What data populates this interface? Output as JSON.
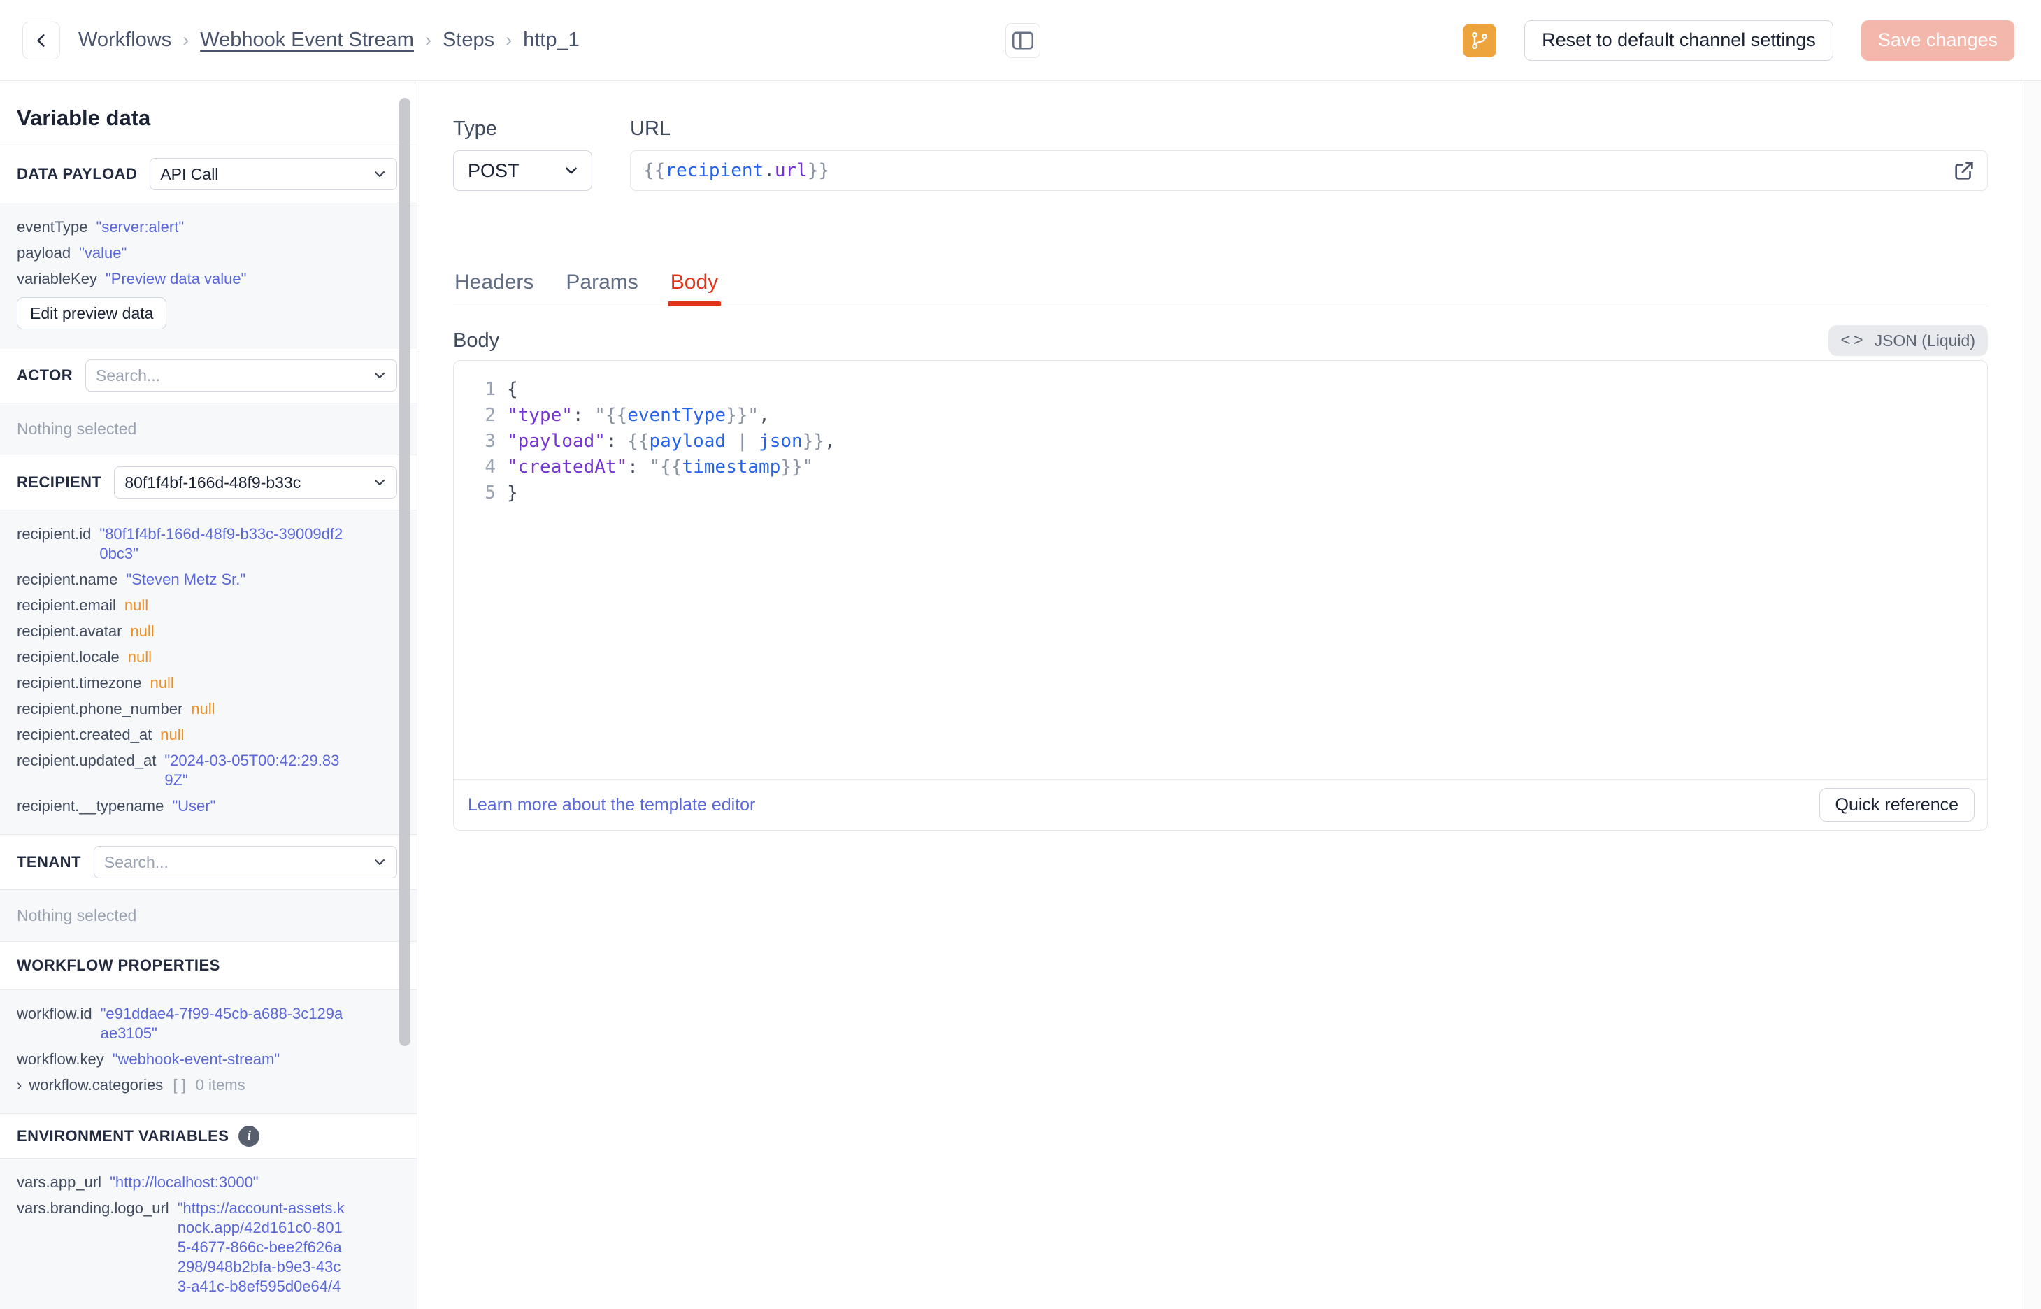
{
  "topbar": {
    "breadcrumb": [
      "Workflows",
      "Webhook Event Stream",
      "Steps",
      "http_1"
    ],
    "breadcrumb_separator": "›",
    "reset_button": "Reset to default channel settings",
    "save_button": "Save changes"
  },
  "sidebar": {
    "title": "Variable data",
    "sections": {
      "data_payload": {
        "label": "DATA PAYLOAD",
        "value": "API Call"
      },
      "preview": {
        "rows": [
          {
            "key": "eventType",
            "value": "\"server:alert\"",
            "type": "string"
          },
          {
            "key": "payload",
            "value": "\"value\"",
            "type": "string"
          },
          {
            "key": "variableKey",
            "value": "\"Preview data value\"",
            "type": "string"
          }
        ],
        "edit_button": "Edit preview data"
      },
      "actor": {
        "label": "ACTOR",
        "placeholder": "Search...",
        "empty": "Nothing selected"
      },
      "recipient": {
        "label": "RECIPIENT",
        "selected": "80f1f4bf-166d-48f9-b33c",
        "rows": [
          {
            "key": "recipient.id",
            "value": "\"80f1f4bf-166d-48f9-b33c-39009df20bc3\"",
            "type": "string"
          },
          {
            "key": "recipient.name",
            "value": "\"Steven Metz Sr.\"",
            "type": "string"
          },
          {
            "key": "recipient.email",
            "value": "null",
            "type": "null"
          },
          {
            "key": "recipient.avatar",
            "value": "null",
            "type": "null"
          },
          {
            "key": "recipient.locale",
            "value": "null",
            "type": "null"
          },
          {
            "key": "recipient.timezone",
            "value": "null",
            "type": "null"
          },
          {
            "key": "recipient.phone_number",
            "value": "null",
            "type": "null"
          },
          {
            "key": "recipient.created_at",
            "value": "null",
            "type": "null"
          },
          {
            "key": "recipient.updated_at",
            "value": "\"2024-03-05T00:42:29.839Z\"",
            "type": "string"
          },
          {
            "key": "recipient.__typename",
            "value": "\"User\"",
            "type": "string"
          }
        ]
      },
      "tenant": {
        "label": "TENANT",
        "placeholder": "Search...",
        "empty": "Nothing selected"
      },
      "workflow": {
        "label": "WORKFLOW PROPERTIES",
        "rows": [
          {
            "key": "workflow.id",
            "value": "\"e91ddae4-7f99-45cb-a688-3c129aae3105\"",
            "type": "string"
          },
          {
            "key": "workflow.key",
            "value": "\"webhook-event-stream\"",
            "type": "string"
          }
        ],
        "categories": {
          "chevron": "›",
          "key": "workflow.categories",
          "brackets": "[ ]",
          "count": "0 items"
        }
      },
      "environment": {
        "label": "ENVIRONMENT VARIABLES",
        "info": "i",
        "rows": [
          {
            "key": "vars.app_url",
            "value": "\"http://localhost:3000\"",
            "type": "string"
          },
          {
            "key": "vars.branding.logo_url",
            "value": "\"https://account-assets.knock.app/42d161c0-8015-4677-866c-bee2f626a298/948b2bfa-b9e3-43c3-a41c-b8ef595d0e64/4",
            "type": "string"
          }
        ]
      }
    }
  },
  "main": {
    "type_label": "Type",
    "type_value": "POST",
    "url_label": "URL",
    "url_tokens": [
      [
        "{{",
        "g"
      ],
      [
        "recipient",
        "b"
      ],
      [
        ".",
        "d"
      ],
      [
        "url",
        "p"
      ],
      [
        "}}",
        "g"
      ]
    ],
    "tabs": [
      {
        "label": "Headers",
        "active": false
      },
      {
        "label": "Params",
        "active": false
      },
      {
        "label": "Body",
        "active": true
      }
    ],
    "body_label": "Body",
    "badge_icon": "<>",
    "language_badge": "JSON (Liquid)",
    "code_lines": [
      {
        "n": "1",
        "t": [
          [
            "{",
            "d"
          ]
        ]
      },
      {
        "n": "2",
        "t": [
          [
            "\"type\"",
            "p"
          ],
          [
            ": ",
            "d"
          ],
          [
            "\"{{",
            "g"
          ],
          [
            "eventType",
            "b"
          ],
          [
            "}}\"",
            "g"
          ],
          [
            ",",
            "d"
          ]
        ]
      },
      {
        "n": "3",
        "t": [
          [
            "\"payload\"",
            "p"
          ],
          [
            ": ",
            "d"
          ],
          [
            "{{",
            "g"
          ],
          [
            "payload",
            "b"
          ],
          [
            " | ",
            "g"
          ],
          [
            "json",
            "b"
          ],
          [
            "}}",
            "g"
          ],
          [
            ",",
            "d"
          ]
        ]
      },
      {
        "n": "4",
        "t": [
          [
            "\"createdAt\"",
            "p"
          ],
          [
            ": ",
            "d"
          ],
          [
            "\"{{",
            "g"
          ],
          [
            "timestamp",
            "b"
          ],
          [
            "}}\"",
            "g"
          ]
        ]
      },
      {
        "n": "5",
        "t": [
          [
            "}",
            "d"
          ]
        ]
      }
    ],
    "footer": {
      "link": "Learn more about the template editor",
      "button": "Quick reference"
    }
  },
  "colors": {
    "accent_red": "#e0351b",
    "string_value": "#5a67d8",
    "null_value": "#ee8f25",
    "token_blue": "#2563eb",
    "token_purple": "#7533d6",
    "commit_orange": "#eda43c",
    "save_disabled_bg": "#f4b7ab"
  }
}
